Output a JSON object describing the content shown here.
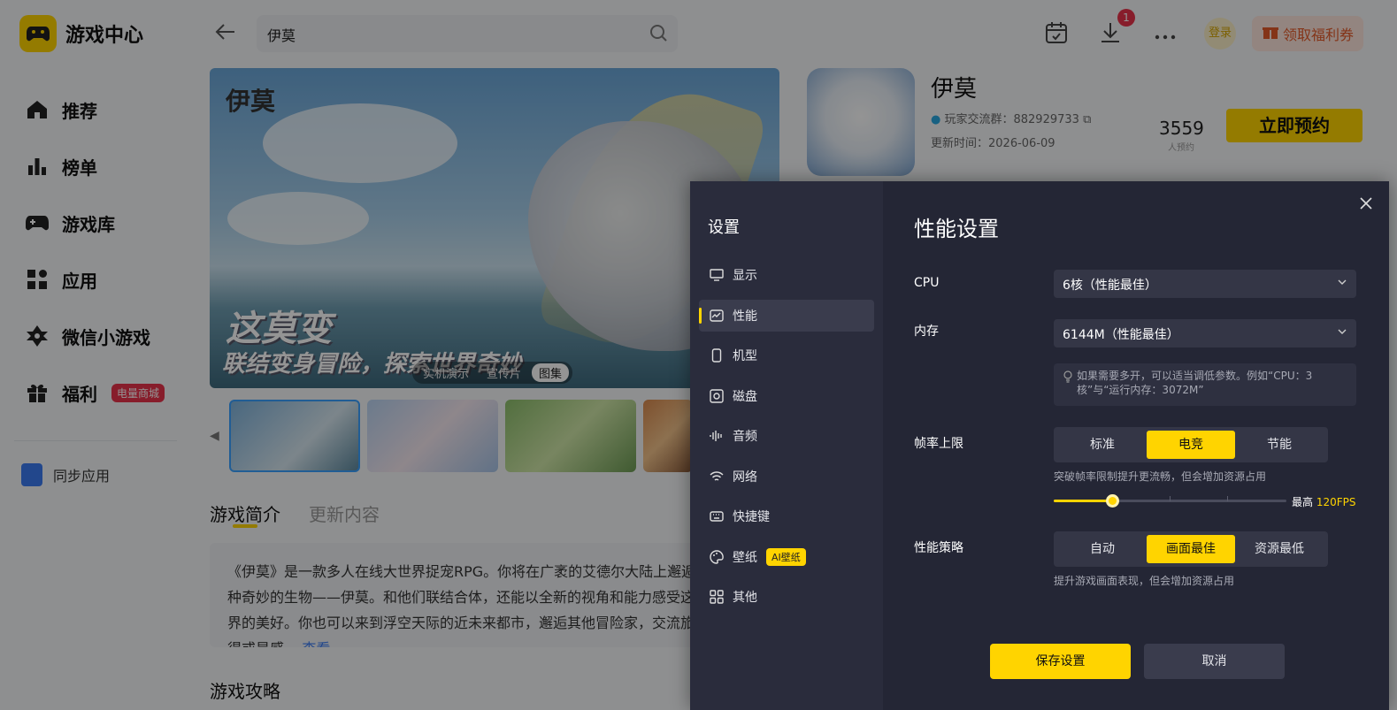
{
  "app": {
    "name": "游戏中心",
    "search": {
      "value": "伊莫"
    },
    "download_count": "1",
    "login_label": "登录",
    "welfare_label": "领取福利券",
    "accent_color": "#ffd400"
  },
  "sidebar": {
    "items": [
      {
        "label": "推荐",
        "icon": "home-icon"
      },
      {
        "label": "榜单",
        "icon": "chart-icon"
      },
      {
        "label": "游戏库",
        "icon": "gamepad-icon"
      },
      {
        "label": "应用",
        "icon": "apps-icon"
      },
      {
        "label": "微信小游戏",
        "icon": "wechat-game-icon"
      },
      {
        "label": "福利",
        "icon": "gift-icon",
        "badge": "电量商城"
      }
    ],
    "sync_label": "同步应用"
  },
  "game": {
    "banner_logo": "伊莫",
    "banner_slogan1": "这莫变",
    "banner_slogan2": "联结变身冒险，探索世界奇妙",
    "media_tabs": [
      {
        "label": "实机演示",
        "active": false
      },
      {
        "label": "宣传片",
        "active": false
      },
      {
        "label": "图集",
        "active": true
      }
    ],
    "name": "伊莫",
    "qq_group": "玩家交流群：882929733",
    "update_time": "更新时间：2026-06-09",
    "reserve_count": "3559",
    "reserve_count_label": "人预约",
    "reserve_button": "立即预约",
    "sections": [
      {
        "label": "游戏简介",
        "active": true
      },
      {
        "label": "更新内容",
        "active": false
      }
    ],
    "description": "《伊莫》是一款多人在线大世界捉宠RPG。你将在广袤的艾德尔大陆上邂逅各种奇妙的生物——伊莫。和他们联结合体，还能以全新的视角和能力感受这个世界的美好。你也可以来到浮空天际的近未来都市，邂逅其他冒险家，交流旅途心得或是感...",
    "description_more": "查看",
    "guide_title": "游戏攻略"
  },
  "settings": {
    "title": "设置",
    "menu": [
      {
        "label": "显示",
        "icon": "monitor-icon",
        "active": false
      },
      {
        "label": "性能",
        "icon": "performance-icon",
        "active": true
      },
      {
        "label": "机型",
        "icon": "phone-icon",
        "active": false
      },
      {
        "label": "磁盘",
        "icon": "disk-icon",
        "active": false
      },
      {
        "label": "音频",
        "icon": "audio-icon",
        "active": false
      },
      {
        "label": "网络",
        "icon": "wifi-icon",
        "active": false
      },
      {
        "label": "快捷键",
        "icon": "keyboard-icon",
        "active": false
      },
      {
        "label": "壁纸",
        "icon": "palette-icon",
        "active": false,
        "badge": "AI壁纸"
      },
      {
        "label": "其他",
        "icon": "grid-icon",
        "active": false
      }
    ],
    "panel_title": "性能设置",
    "cpu": {
      "label": "CPU",
      "value": "6核（性能最佳）"
    },
    "memory": {
      "label": "内存",
      "value": "6144M（性能最佳）"
    },
    "hint": "如果需要多开，可以适当调低参数。例如“CPU：3核”与“运行内存：3072M”",
    "frame_rate": {
      "label": "帧率上限",
      "options": [
        "标准",
        "电竞",
        "节能"
      ],
      "selected": "电竞",
      "note": "突破帧率限制提升更流畅，但会增加资源占用",
      "slider_fraction": 0.25,
      "max_label": "最高",
      "max_value": "120FPS"
    },
    "strategy": {
      "label": "性能策略",
      "options": [
        "自动",
        "画面最佳",
        "资源最低"
      ],
      "selected": "画面最佳",
      "note": "提升游戏画面表现，但会增加资源占用"
    },
    "save_label": "保存设置",
    "cancel_label": "取消"
  }
}
